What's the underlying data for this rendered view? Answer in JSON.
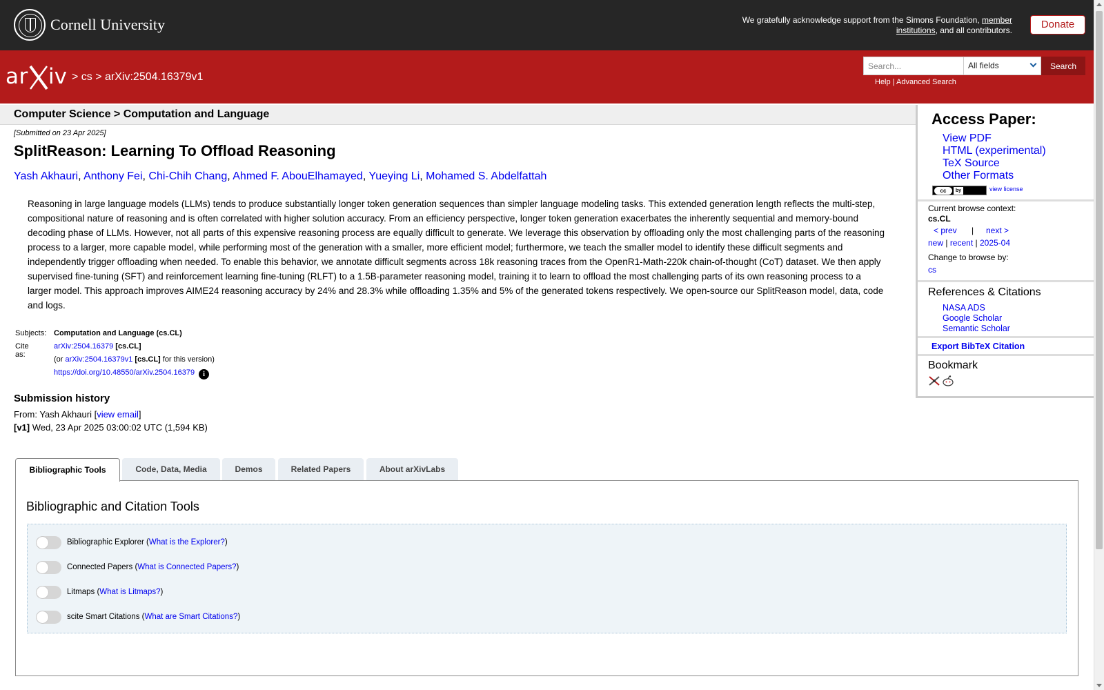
{
  "header": {
    "university": "Cornell University",
    "ack_text": "We gratefully acknowledge support from the Simons Foundation, ",
    "ack_link": "member institutions",
    "ack_tail": ", and all contributors.",
    "donate": "Donate"
  },
  "arxiv": {
    "logo": "arXiv",
    "crumb_sep1": "> ",
    "crumb_cs": "cs",
    "crumb_sep2": " > ",
    "crumb_id": "arXiv:2504.16379v1",
    "search_placeholder": "Search...",
    "search_field": "All fields",
    "search_button": "Search",
    "help": "Help",
    "help_sep": " | ",
    "advanced": "Advanced Search"
  },
  "category": "Computer Science > Computation and Language",
  "paper": {
    "submitted": "[Submitted on 23 Apr 2025]",
    "title": "SplitReason: Learning To Offload Reasoning",
    "authors": [
      "Yash Akhauri",
      "Anthony Fei",
      "Chi-Chih Chang",
      "Ahmed F. AbouElhamayed",
      "Yueying Li",
      "Mohamed S. Abdelfattah"
    ],
    "abstract": "Reasoning in large language models (LLMs) tends to produce substantially longer token generation sequences than simpler language modeling tasks. This extended generation length reflects the multi-step, compositional nature of reasoning and is often correlated with higher solution accuracy. From an efficiency perspective, longer token generation exacerbates the inherently sequential and memory-bound decoding phase of LLMs. However, not all parts of this expensive reasoning process are equally difficult to generate. We leverage this observation by offloading only the most challenging parts of the reasoning process to a larger, more capable model, while performing most of the generation with a smaller, more efficient model; furthermore, we teach the smaller model to identify these difficult segments and independently trigger offloading when needed. To enable this behavior, we annotate difficult segments across 18k reasoning traces from the OpenR1-Math-220k chain-of-thought (CoT) dataset. We then apply supervised fine-tuning (SFT) and reinforcement learning fine-tuning (RLFT) to a 1.5B-parameter reasoning model, training it to learn to offload the most challenging parts of its own reasoning process to a larger model. This approach improves AIME24 reasoning accuracy by 24% and 28.3% while offloading 1.35% and 5% of the generated tokens respectively. We open-source our SplitReason model, data, code and logs."
  },
  "meta": {
    "subjects_label": "Subjects:",
    "subjects_value": "Computation and Language (cs.CL)",
    "cite_label": "Cite as:",
    "cite_id": "arXiv:2504.16379",
    "cite_cat": " [cs.CL]",
    "or_prefix": "(or ",
    "version_id": "arXiv:2504.16379v1",
    "version_cat": " [cs.CL]",
    "version_suffix": " for this version)",
    "doi": "https://doi.org/10.48550/arXiv.2504.16379",
    "info_glyph": "i"
  },
  "history": {
    "title": "Submission history",
    "from_prefix": "From: Yash Akhauri [",
    "view_email": "view email",
    "from_suffix": "]",
    "v1_label": "[v1]",
    "v1_text": " Wed, 23 Apr 2025 03:00:02 UTC (1,594 KB)"
  },
  "tabs": [
    "Bibliographic Tools",
    "Code, Data, Media",
    "Demos",
    "Related Papers",
    "About arXivLabs"
  ],
  "tools": {
    "panel_title": "Bibliographic and Citation Tools",
    "items": [
      {
        "label": "Bibliographic Explorer (",
        "link": "What is the Explorer?",
        "close": ")"
      },
      {
        "label": "Connected Papers (",
        "link": "What is Connected Papers?",
        "close": ")"
      },
      {
        "label": "Litmaps (",
        "link": "What is Litmaps?",
        "close": ")"
      },
      {
        "label": "scite Smart Citations (",
        "link": "What are Smart Citations?",
        "close": ")"
      }
    ]
  },
  "sidebar": {
    "access_title": "Access Paper:",
    "access_links": [
      "View PDF",
      "HTML (experimental)",
      "TeX Source",
      "Other Formats"
    ],
    "license_badge": "cc by",
    "view_license": "view license",
    "browse_context_label": "Current browse context:",
    "browse_context_value": "cs.CL",
    "prev": "< prev",
    "nav_sep": "|",
    "next": "next >",
    "new": "new",
    "recent": "recent",
    "month": "2025-04",
    "change_label": "Change to browse by:",
    "change_value": "cs",
    "refs_title": "References & Citations",
    "refs": [
      "NASA ADS",
      "Google Scholar",
      "Semantic Scholar"
    ],
    "bibtex": "Export BibTeX Citation",
    "bookmark_title": "Bookmark"
  },
  "colors": {
    "arxiv_red": "#b31b1b",
    "cornell_bar": "#262626",
    "link": "#0000ee"
  }
}
